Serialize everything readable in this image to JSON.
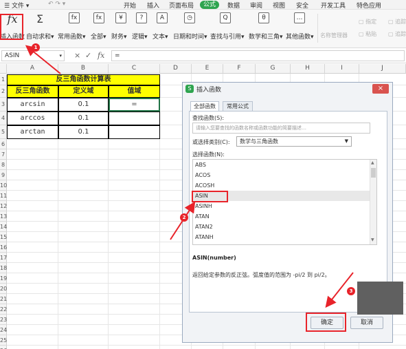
{
  "menubar": {
    "file_label": "文件",
    "items": [
      "开始",
      "插入",
      "页面布局",
      "公式",
      "数据",
      "审阅",
      "视图",
      "安全",
      "开发工具",
      "特色应用"
    ],
    "active_item": "公式"
  },
  "ribbon": {
    "buttons": [
      {
        "label": "插入函数",
        "icon": "fx"
      },
      {
        "label": "自动求和",
        "icon": "Σ"
      },
      {
        "label": "常用函数",
        "icon": "fx"
      },
      {
        "label": "全部",
        "icon": "fx"
      },
      {
        "label": "财务",
        "icon": "¥"
      },
      {
        "label": "逻辑",
        "icon": "?"
      },
      {
        "label": "文本",
        "icon": "A"
      },
      {
        "label": "日期和时间",
        "icon": "◷"
      },
      {
        "label": "查找与引用",
        "icon": "Q"
      },
      {
        "label": "数学和三角",
        "icon": "θ"
      },
      {
        "label": "其他函数",
        "icon": "…"
      }
    ],
    "name_manager_label": "名称管理器",
    "paste_label": "粘贴",
    "specify_label": "指定",
    "trace_label_1": "追踪",
    "trace_label_2": "追踪"
  },
  "formula_bar": {
    "name_box": "ASIN",
    "cancel_icon": "×",
    "confirm_icon": "✓",
    "fx_icon": "fx",
    "formula": "="
  },
  "sheet": {
    "columns": [
      "A",
      "B",
      "C",
      "D",
      "E",
      "F",
      "G",
      "H",
      "I",
      "J"
    ],
    "rows": [
      "1",
      "2",
      "3",
      "4",
      "5",
      "6",
      "7",
      "8",
      "9",
      "10",
      "11",
      "12",
      "13",
      "14",
      "15",
      "16",
      "17",
      "18",
      "19",
      "20",
      "21",
      "22",
      "23",
      "24",
      "25",
      "26"
    ],
    "table_title": "反三角函数计算表",
    "headers": [
      "反三角函数",
      "定义域",
      "值域"
    ],
    "data_rows": [
      [
        "arcsin",
        "0.1",
        "="
      ],
      [
        "arccos",
        "0.1",
        ""
      ],
      [
        "arctan",
        "0.1",
        ""
      ]
    ]
  },
  "dialog": {
    "title": "插入函数",
    "logo": "S",
    "close_icon": "×",
    "tabs": [
      "全部函数",
      "常用公式"
    ],
    "search_label": "查找函数(S):",
    "search_placeholder": "请输入您要查找的函数名称或函数功能的简要描述…",
    "category_label": "或选择类别(C):",
    "category_value": "数学与三角函数",
    "list_label": "选择函数(N):",
    "functions": [
      "ABS",
      "ACOS",
      "ACOSH",
      "ASIN",
      "ASINH",
      "ATAN",
      "ATAN2",
      "ATANH"
    ],
    "selected_function": "ASIN",
    "signature": "ASIN(number)",
    "description": "返回给定参数的反正弦。弧度值的范围为 -pi/2 到 pi/2。",
    "ok_label": "确定",
    "cancel_label": "取消"
  },
  "annotations": {
    "badges": [
      "1",
      "2",
      "3"
    ],
    "color": "#e8232a"
  },
  "colors": {
    "accent_green": "#2ea44f",
    "title_yellow": "#ffff00",
    "selection_green": "#217346"
  }
}
